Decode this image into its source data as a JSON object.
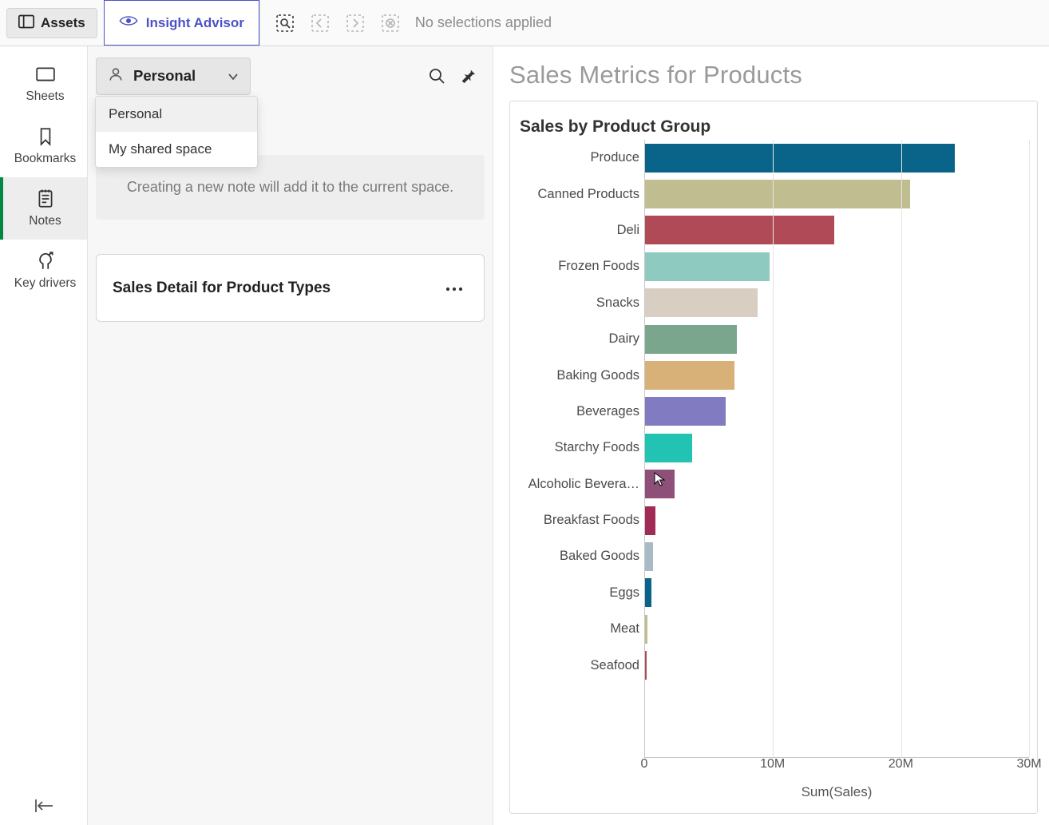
{
  "toolbar": {
    "assets_label": "Assets",
    "insight_label": "Insight Advisor",
    "no_selections": "No selections applied"
  },
  "left_rail": {
    "items": [
      {
        "label": "Sheets",
        "key": "sheets"
      },
      {
        "label": "Bookmarks",
        "key": "bookmarks"
      },
      {
        "label": "Notes",
        "key": "notes"
      },
      {
        "label": "Key drivers",
        "key": "keydrivers"
      }
    ],
    "active_index": 2
  },
  "filter": {
    "selected_label": "Personal",
    "options": [
      "Personal",
      "My shared space"
    ]
  },
  "center": {
    "info_text": "Creating a new note will add it to the current space.",
    "note_title": "Sales Detail for Product Types"
  },
  "right": {
    "page_title": "Sales Metrics for Products",
    "chart_title": "Sales by Product Group"
  },
  "chart_data": {
    "type": "bar",
    "orientation": "horizontal",
    "title": "Sales by Product Group",
    "xlabel": "Sum(Sales)",
    "ylabel": "",
    "xlim": [
      0,
      30000000
    ],
    "xticks": [
      0,
      10000000,
      20000000,
      30000000
    ],
    "xtick_labels": [
      "0",
      "10M",
      "20M",
      "30M"
    ],
    "categories": [
      "Produce",
      "Canned Products",
      "Deli",
      "Frozen Foods",
      "Snacks",
      "Dairy",
      "Baking Goods",
      "Beverages",
      "Starchy Foods",
      "Alcoholic Bevera…",
      "Breakfast Foods",
      "Baked Goods",
      "Eggs",
      "Meat",
      "Seafood"
    ],
    "values": [
      24200000,
      20700000,
      14800000,
      9700000,
      8800000,
      7200000,
      7000000,
      6300000,
      3700000,
      2300000,
      800000,
      600000,
      500000,
      200000,
      100000
    ],
    "colors": [
      "#0a6489",
      "#c0bd90",
      "#b04a57",
      "#8ecac0",
      "#d8cfc2",
      "#7aa68e",
      "#d8b179",
      "#817bc1",
      "#22c3b2",
      "#8e5079",
      "#a02b55",
      "#a9b9c5",
      "#0a6489",
      "#c0bd90",
      "#b04a57"
    ]
  }
}
